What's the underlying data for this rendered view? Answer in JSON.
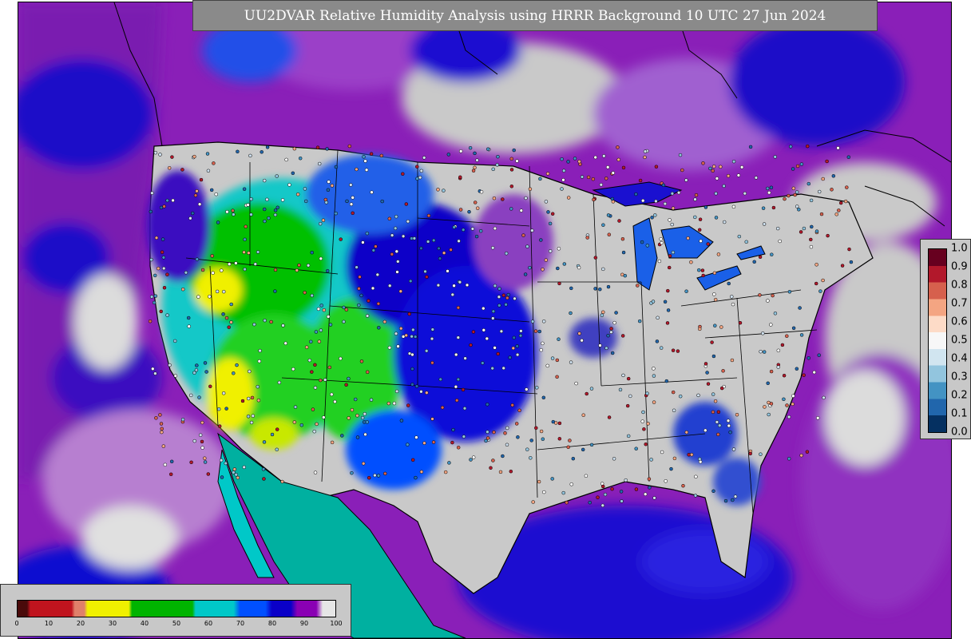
{
  "title": "UU2DVAR Relative Humidity Analysis using HRRR Background 10 UTC 27 Jun 2024",
  "rh_legend": {
    "ticks": [
      "0",
      "10",
      "20",
      "30",
      "40",
      "50",
      "60",
      "70",
      "80",
      "90",
      "100"
    ],
    "colors": {
      "dark": "#4a0a0a",
      "red": "#c0141e",
      "salmon": "#e0806a",
      "yellow": "#f0f000",
      "green": "#00b400",
      "cyan": "#00c8c8",
      "blue": "#0050ff",
      "navy": "#0a00c8",
      "purple": "#8a00b4",
      "light": "#e6e6e6"
    }
  },
  "ratio_legend": {
    "ticks": [
      "1.0",
      "0.9",
      "0.8",
      "0.7",
      "0.6",
      "0.5",
      "0.4",
      "0.3",
      "0.2",
      "0.1",
      "0.0"
    ],
    "colors": [
      "#67001f",
      "#b2182b",
      "#d6604d",
      "#f4a582",
      "#fddbc7",
      "#f7f7f7",
      "#d1e5f0",
      "#92c5de",
      "#4393c3",
      "#2166ac",
      "#053061"
    ]
  },
  "map": {
    "land_color": "#c9c9c9",
    "border_color": "#000000"
  }
}
